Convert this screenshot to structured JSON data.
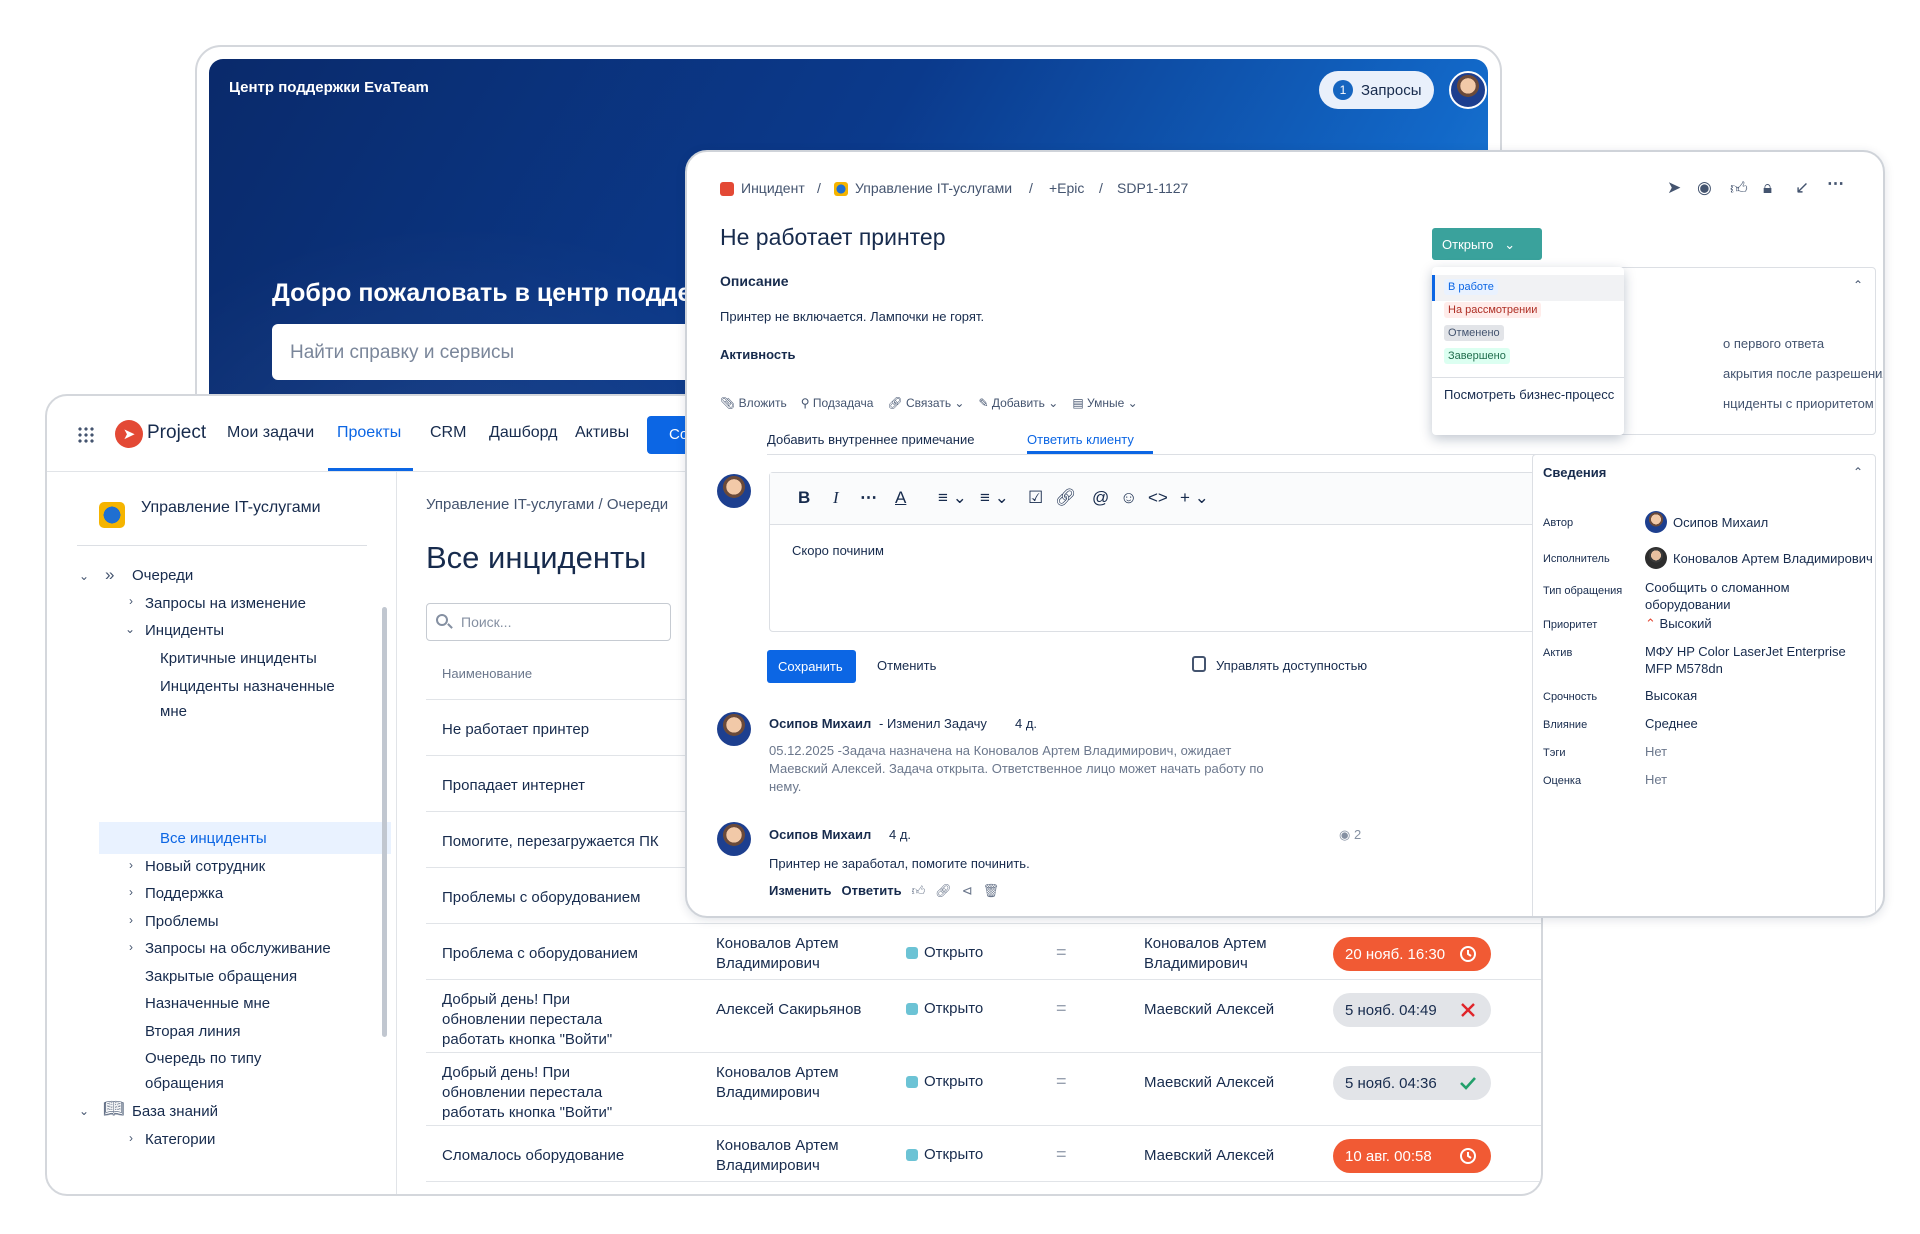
{
  "portal": {
    "brand": "Центр поддержки EvaTeam",
    "requests_label": "Запросы",
    "requests_count": "1",
    "welcome": "Добро пожаловать в центр поддержки",
    "search_placeholder": "Найти справку и сервисы"
  },
  "project": {
    "logo_text": "Project",
    "nav": [
      "Мои задачи",
      "Проекты",
      "CRM",
      "Дашборд",
      "Активы"
    ],
    "create_label": "Со",
    "sidebar": {
      "project_title": "Управление IT-услугами",
      "queues": "Очереди",
      "items": [
        "Запросы на изменение",
        "Инциденты",
        "Критичные инциденты",
        "Инциденты назначенные мне",
        "Все инциденты",
        "Новый сотрудник",
        "Поддержка",
        "Проблемы",
        "Запросы на обслуживание",
        "Закрытые обращения",
        "Назначенные мне",
        "Вторая линия",
        "Очередь по типу обращения"
      ],
      "knowledge_base": "База знаний",
      "categories": "Категории"
    },
    "breadcrumb": "Управление IT-услугами / Очереди",
    "page_title": "Все инциденты",
    "search_placeholder": "Поиск...",
    "col_name": "Наименование",
    "rows": [
      {
        "name": "Не работает принтер"
      },
      {
        "name": "Пропадает интернет"
      },
      {
        "name": "Помогите, перезагружается ПК"
      },
      {
        "name": "Проблемы с оборудованием"
      },
      {
        "name": "Проблема с оборудованием",
        "author": "Коновалов Артем Владимирович",
        "status": "Открыто",
        "assignee": "Коновалов Артем Владимирович",
        "sla": "20 нояб. 16:30",
        "sla_state": "red-clock"
      },
      {
        "name": "Добрый день! При обновлении перестала работать кнопка \"Войти\"",
        "author": "Алексей Сакирьянов",
        "status": "Открыто",
        "assignee": "Маевский Алексей",
        "sla": "5 нояб. 04:49",
        "sla_state": "gray-cross"
      },
      {
        "name": "Добрый день! При обновлении перестала работать кнопка \"Войти\"",
        "author": "Коновалов Артем Владимирович",
        "status": "Открыто",
        "assignee": "Маевский Алексей",
        "sla": "5 нояб. 04:36",
        "sla_state": "gray-check"
      },
      {
        "name": "Сломалось оборудование",
        "author": "Коновалов Артем Владимирович",
        "status": "Открыто",
        "assignee": "Маевский Алексей",
        "sla": "10 авг. 00:58",
        "sla_state": "red-clock"
      }
    ],
    "eq_symbol": "="
  },
  "issue": {
    "breadcrumb": [
      "Инцидент",
      "Управление IT-услугами",
      "+Epic",
      "SDP1-1127"
    ],
    "title": "Не работает принтер",
    "description_label": "Описание",
    "description": "Принтер не включается. Лампочки не горят.",
    "activity_label": "Активность",
    "actions": [
      "Вложить",
      "Подзадача",
      "Связать",
      "Добавить",
      "Умные"
    ],
    "tab_internal": "Добавить внутреннее примечание",
    "tab_reply": "Ответить клиенту",
    "editor_text": "Скоро починим",
    "save": "Сохранить",
    "cancel": "Отменить",
    "access": "Управлять доступностью",
    "comments": [
      {
        "author": "Осипов Михаил",
        "action": "- Изменил Задачу",
        "age": "4 д.",
        "body": "05.12.2025 -Задача назначена на Коновалов Артем Владимирович, ожидает Маевский Алексей. Задача открыта. Ответственное лицо может начать работу по нему."
      },
      {
        "author": "Осипов Михаил",
        "age": "4 д.",
        "body": "Принтер не заработал, помогите починить.",
        "views": "2"
      }
    ],
    "comment_edit": "Изменить",
    "comment_reply": "Ответить",
    "status_button": "Открыто",
    "status_options": [
      "В работе",
      "На рассмотрении",
      "Отменено",
      "Завершено"
    ],
    "view_process": "Посмотреть бизнес-процесс",
    "sla_panel_items": [
      "о первого ответа",
      "акрытия после разрешения",
      "нциденты с приоритетом"
    ],
    "details_label": "Сведения",
    "details": [
      {
        "label": "Автор",
        "value": "Осипов Михаил"
      },
      {
        "label": "Исполнитель",
        "value": "Коновалов Артем Владимирович"
      },
      {
        "label": "Тип обращения",
        "value": "Сообщить о сломанном оборудовании"
      },
      {
        "label": "Приоритет",
        "value": "Высокий"
      },
      {
        "label": "Актив",
        "value": "МФУ HP Color LaserJet Enterprise MFP M578dn"
      },
      {
        "label": "Срочность",
        "value": "Высокая"
      },
      {
        "label": "Влияние",
        "value": "Среднее"
      },
      {
        "label": "Тэги",
        "value": "Нет"
      },
      {
        "label": "Оценка",
        "value": "Нет"
      }
    ]
  },
  "colors": {
    "accent": "#0c66e4",
    "status_teal": "#3aa29c",
    "sla_red": "#f15a34",
    "brand_red": "#e34935"
  }
}
